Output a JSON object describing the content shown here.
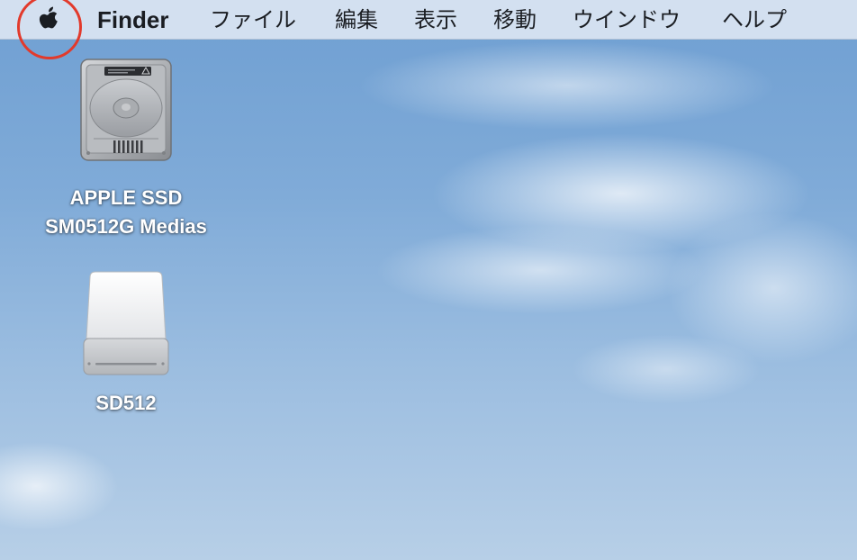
{
  "menubar": {
    "apple_icon": "apple-logo-icon",
    "app_name": "Finder",
    "items": [
      "ファイル",
      "編集",
      "表示",
      "移動",
      "ウインドウ",
      "ヘルプ"
    ],
    "highlight_color": "#e23a2c"
  },
  "desktop": {
    "icons": [
      {
        "icon": "internal-hard-drive-icon",
        "label_line1": "APPLE SSD",
        "label_line2": "SM0512G Medias"
      },
      {
        "icon": "external-drive-icon",
        "label_line1": "SD512"
      }
    ]
  }
}
